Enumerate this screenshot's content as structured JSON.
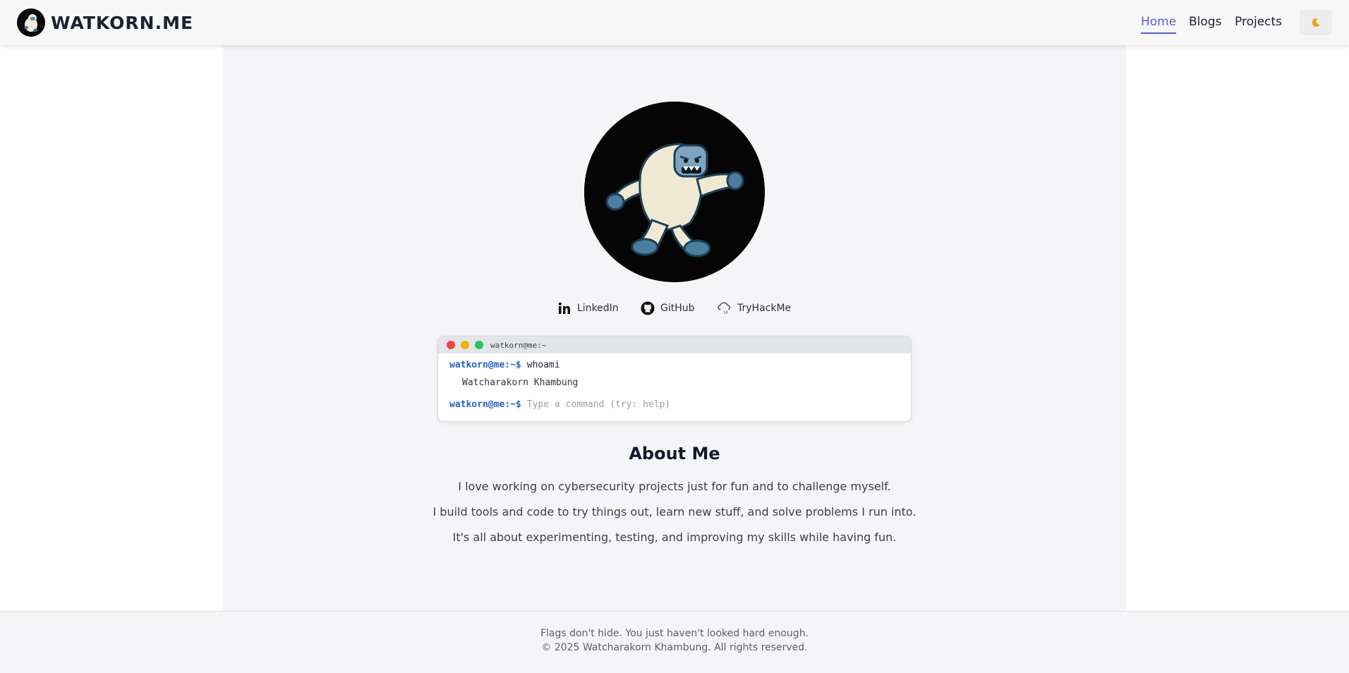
{
  "header": {
    "brand_name": "WATKORN.ME",
    "logo_icon": "yeti-icon",
    "nav": [
      {
        "label": "Home",
        "active": true
      },
      {
        "label": "Blogs",
        "active": false
      },
      {
        "label": "Projects",
        "active": false
      }
    ],
    "theme_toggle_icon": "moon-icon",
    "accent_color": "#5b5fc7"
  },
  "profile": {
    "avatar_icon": "yeti-icon",
    "socials": [
      {
        "label": "LinkedIn",
        "icon": "linkedin-icon"
      },
      {
        "label": "GitHub",
        "icon": "github-icon"
      },
      {
        "label": "TryHackMe",
        "icon": "tryhackme-icon"
      }
    ]
  },
  "terminal": {
    "title": "watkorn@me:~",
    "prompt": "watkorn@me:~$",
    "history": [
      {
        "command": "whoami",
        "output": "Watcharakorn Khambung"
      }
    ],
    "input_placeholder": "Type a command (try: help)",
    "input_value": ""
  },
  "about": {
    "title": "About Me",
    "paragraphs": [
      "I love working on cybersecurity projects just for fun and to challenge myself.",
      "I build tools and code to try things out, learn new stuff, and solve problems I run into.",
      "It's all about experimenting, testing, and improving my skills while having fun."
    ]
  },
  "footer": {
    "tagline": "Flags don't hide. You just haven't looked hard enough.",
    "copyright": "© 2025 Watcharakorn Khambung. All rights reserved."
  }
}
